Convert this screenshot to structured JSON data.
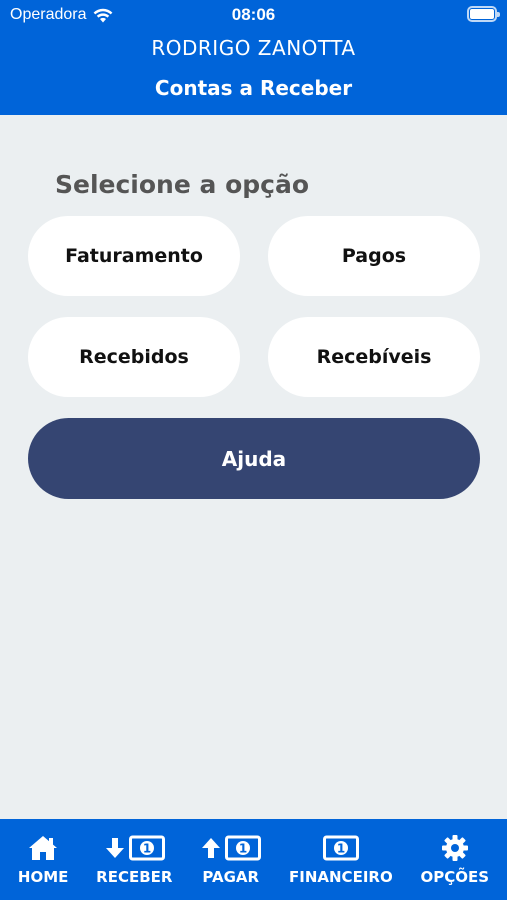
{
  "status_bar": {
    "carrier": "Operadora",
    "time": "08:06"
  },
  "header": {
    "user_name": "RODRIGO ZANOTTA",
    "title": "Contas a Receber"
  },
  "main": {
    "section_label": "Selecione a opção",
    "options": [
      {
        "label": "Faturamento"
      },
      {
        "label": "Pagos"
      },
      {
        "label": "Recebidos"
      },
      {
        "label": "Recebíveis"
      }
    ],
    "help_label": "Ajuda"
  },
  "tabbar": {
    "items": [
      {
        "label": "HOME",
        "icon": "home-icon"
      },
      {
        "label": "RECEBER",
        "icon": "arrow-down-money-icon"
      },
      {
        "label": "PAGAR",
        "icon": "arrow-up-money-icon"
      },
      {
        "label": "FINANCEIRO",
        "icon": "money-icon"
      },
      {
        "label": "OPÇÕES",
        "icon": "gear-icon"
      }
    ]
  },
  "colors": {
    "primary_blue": "#0064d9",
    "help_button": "#354572",
    "background": "#ebeff1"
  }
}
